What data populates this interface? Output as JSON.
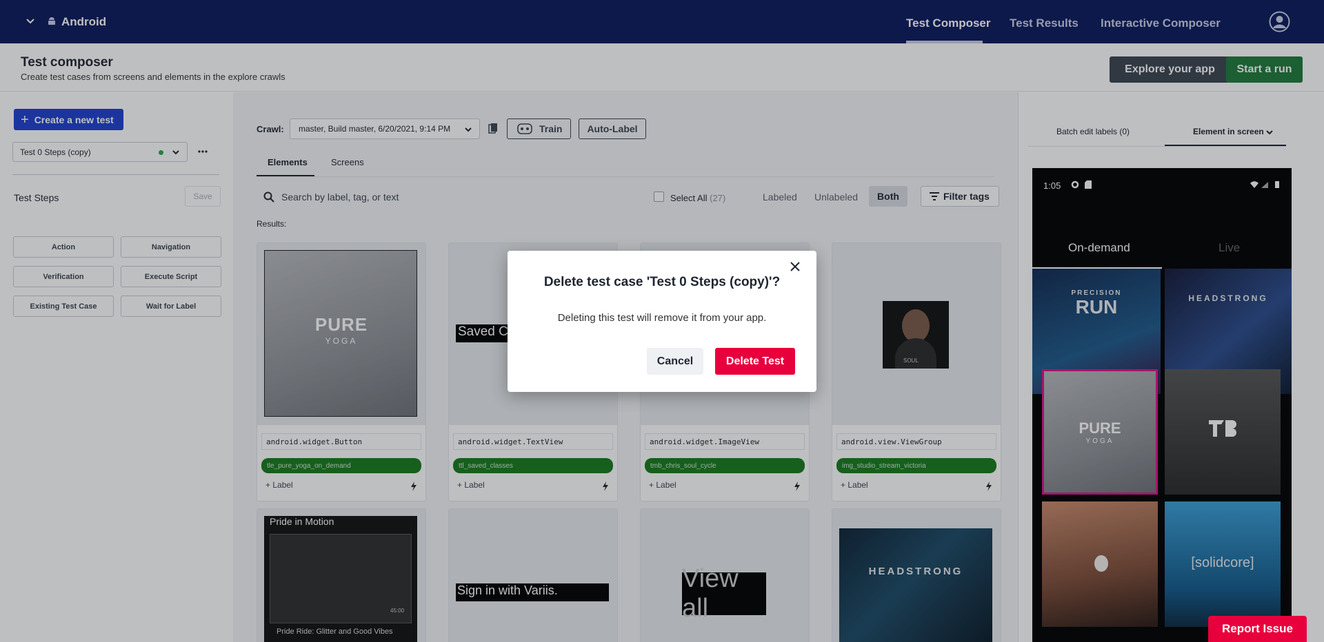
{
  "topnav": {
    "platform": "Android",
    "links": [
      "Test Composer",
      "Test Results",
      "Interactive Composer"
    ]
  },
  "subheader": {
    "title": "Test composer",
    "description": "Create test cases from screens and elements in the explore crawls",
    "explore_label": "Explore your app",
    "start_label": "Start a run"
  },
  "left": {
    "create_label": "Create a new test",
    "selected_test": "Test 0 Steps (copy)",
    "steps_label": "Test Steps",
    "save_label": "Save",
    "step_buttons": [
      "Action",
      "Navigation",
      "Verification",
      "Execute Script",
      "Existing Test Case",
      "Wait for Label"
    ]
  },
  "main": {
    "crawl_label": "Crawl:",
    "crawl_value": "master, Build master, 6/20/2021, 9:14 PM",
    "train_label": "Train",
    "autolabel_label": "Auto-Label",
    "tabs": [
      "Elements",
      "Screens"
    ],
    "search_placeholder": "Search by label, tag, or text",
    "select_all": "Select All",
    "select_all_count": "(27)",
    "filters": [
      "Labeled",
      "Unlabeled",
      "Both"
    ],
    "filter_tags": "Filter tags",
    "results_label": "Results:",
    "cards": [
      {
        "cls": "android.widget.Button",
        "tag": "tle_pure_yoga_on_demand",
        "add": "+ Label",
        "thumb_text": "PURE",
        "thumb_sub": "YOGA"
      },
      {
        "cls": "android.widget.TextView",
        "tag": "ttl_saved_classes",
        "add": "+ Label",
        "thumb_text": "Saved Cla"
      },
      {
        "cls": "android.widget.ImageView",
        "tag": "tmb_chris_soul_cycle",
        "add": "+ Label"
      },
      {
        "cls": "android.view.ViewGroup",
        "tag": "img_studio_stream_victoria",
        "add": "+ Label",
        "thumb_text": "SOUL"
      }
    ],
    "cards_row2": [
      {
        "title": "Pride in Motion",
        "sub": "Pride Ride: Glitter and Good Vibes",
        "time": "45:00"
      },
      {
        "text": "Sign in with Variis."
      },
      {
        "text": "View all"
      },
      {
        "text": "HEADSTRONG"
      }
    ]
  },
  "right": {
    "tabs": [
      "Batch edit labels (0)",
      "Element in screen"
    ],
    "phone": {
      "time": "1:05",
      "tab_on": "On-demand",
      "tab_live": "Live",
      "tiles": [
        "PRECISION",
        "RUN",
        "HEADSTRONG",
        "PURE",
        "YOGA",
        "[solidcore]"
      ]
    }
  },
  "modal": {
    "title": "Delete test case 'Test 0 Steps (copy)'?",
    "body": "Deleting this test will remove it from your app.",
    "cancel_label": "Cancel",
    "delete_label": "Delete Test"
  },
  "report_label": "Report Issue"
}
